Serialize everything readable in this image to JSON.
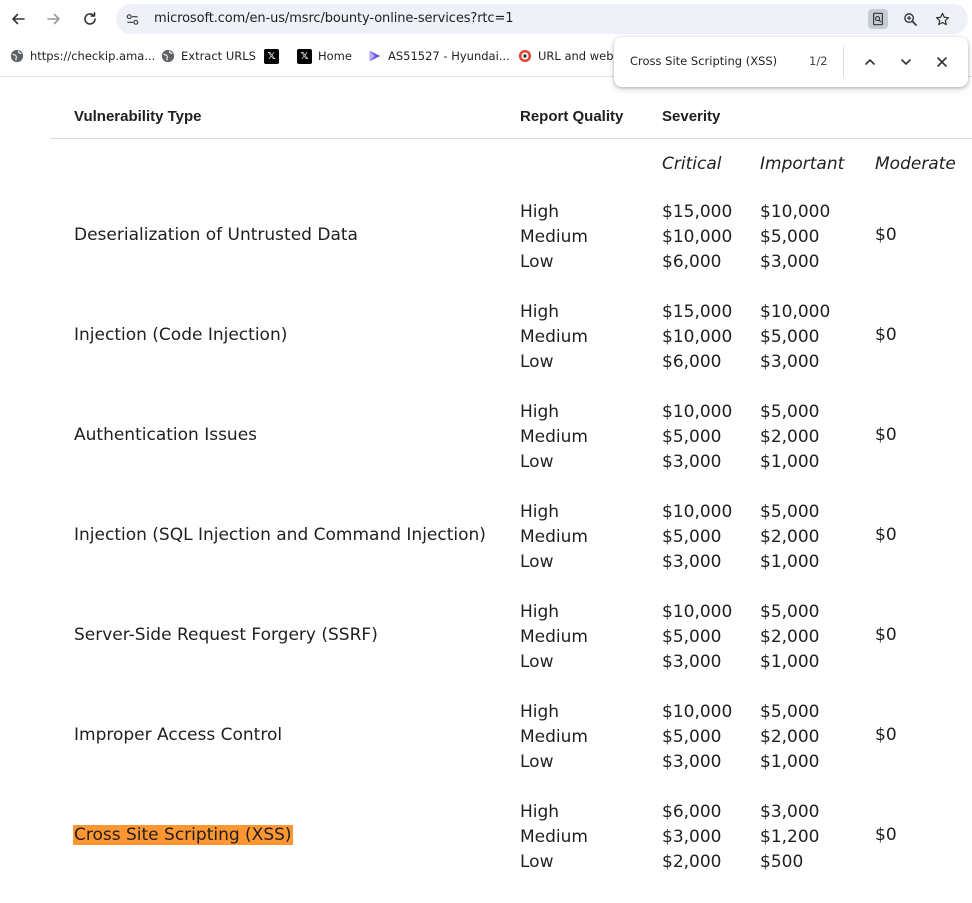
{
  "browser": {
    "url": "microsoft.com/en-us/msrc/bounty-online-services?rtc=1",
    "bookmarks": [
      {
        "label": "https://checkip.ama...",
        "icon": "globe-icon"
      },
      {
        "label": "Extract URLS",
        "icon": "globe-icon"
      },
      {
        "label": "",
        "icon": "x-logo-icon"
      },
      {
        "label": "Home",
        "icon": "x-logo-icon"
      },
      {
        "label": "AS51527 - Hyundai...",
        "icon": "bgp-icon"
      },
      {
        "label": "URL and webs",
        "icon": "target-icon"
      }
    ]
  },
  "find_bar": {
    "query": "Cross Site Scripting (XSS)",
    "count": "1/2"
  },
  "table": {
    "headers": {
      "vuln_type": "Vulnerability Type",
      "report_quality": "Report Quality",
      "severity": "Severity"
    },
    "severity_levels": {
      "critical": "Critical",
      "important": "Important",
      "moderate": "Moderate"
    },
    "quality_labels": [
      "High",
      "Medium",
      "Low"
    ],
    "rows": [
      {
        "name": "Deserialization of Untrusted Data",
        "critical": [
          "$15,000",
          "$10,000",
          "$6,000"
        ],
        "important": [
          "$10,000",
          "$5,000",
          "$3,000"
        ],
        "moderate": "$0"
      },
      {
        "name": "Injection (Code Injection)",
        "critical": [
          "$15,000",
          "$10,000",
          "$6,000"
        ],
        "important": [
          "$10,000",
          "$5,000",
          "$3,000"
        ],
        "moderate": "$0"
      },
      {
        "name": "Authentication Issues",
        "critical": [
          "$10,000",
          "$5,000",
          "$3,000"
        ],
        "important": [
          "$5,000",
          "$2,000",
          "$1,000"
        ],
        "moderate": "$0"
      },
      {
        "name": "Injection (SQL Injection and Command Injection)",
        "critical": [
          "$10,000",
          "$5,000",
          "$3,000"
        ],
        "important": [
          "$5,000",
          "$2,000",
          "$1,000"
        ],
        "moderate": "$0"
      },
      {
        "name": "Server-Side Request Forgery (SSRF)",
        "critical": [
          "$10,000",
          "$5,000",
          "$3,000"
        ],
        "important": [
          "$5,000",
          "$2,000",
          "$1,000"
        ],
        "moderate": "$0"
      },
      {
        "name": "Improper Access Control",
        "critical": [
          "$10,000",
          "$5,000",
          "$3,000"
        ],
        "important": [
          "$5,000",
          "$2,000",
          "$1,000"
        ],
        "moderate": "$0"
      },
      {
        "name": "Cross Site Scripting (XSS)",
        "critical": [
          "$6,000",
          "$3,000",
          "$2,000"
        ],
        "important": [
          "$3,000",
          "$1,200",
          "$500"
        ],
        "moderate": "$0",
        "find_match": true
      }
    ]
  },
  "colors": {
    "find_highlight": "#ff9632",
    "omnibox_bg": "#eef1f8"
  }
}
